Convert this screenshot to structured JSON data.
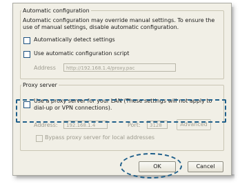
{
  "auto_config": {
    "legend": "Automatic configuration",
    "desc_line1": "Automatic configuration may override manual settings.  To ensure the",
    "desc_line2": "use of manual settings, disable automatic configuration.",
    "detect_label": "Automatically detect settings",
    "script_label": "Use automatic configuration script",
    "address_label": "Address",
    "address_value": "http://192.168.1.4/proxy.pac"
  },
  "proxy": {
    "legend": "Proxy server",
    "use_label_line1": "Use a proxy server for your LAN (These settings will not apply to",
    "use_label_line2": "dial-up or VPN connections).",
    "address_label": "Address:",
    "address_value": "192.168.1.4",
    "port_label": "Port:",
    "port_value": "3128",
    "advanced_label": "Advanced",
    "bypass_label": "Bypass proxy server for local addresses"
  },
  "buttons": {
    "ok": "OK",
    "cancel": "Cancel"
  },
  "colors": {
    "dialog_bg": "#f1efe6",
    "highlight": "#1f5f8a"
  }
}
